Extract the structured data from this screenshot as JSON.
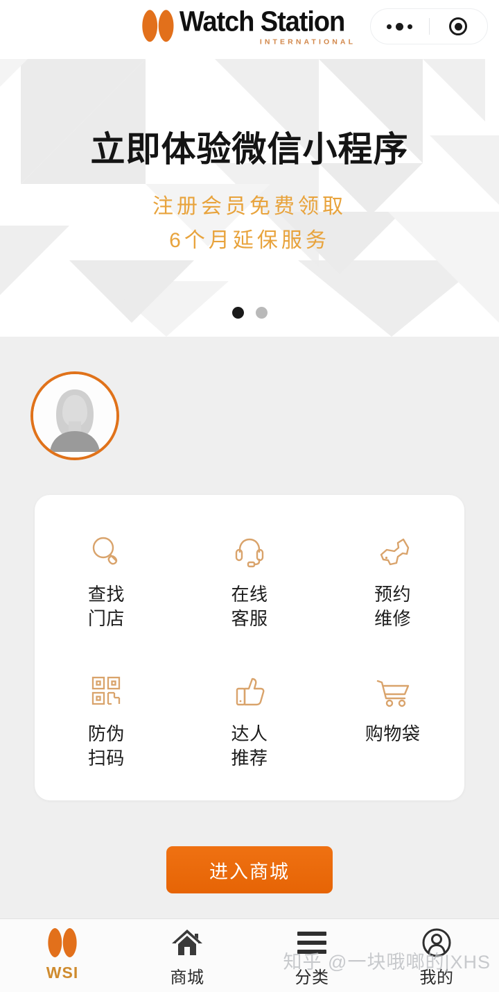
{
  "header": {
    "logo_word": "Watch Station",
    "logo_sub": "INTERNATIONAL",
    "logo_icon": "watch-station-petals-logo",
    "capsule": {
      "menu_icon": "ellipsis-icon",
      "close_icon": "target-circle-icon"
    }
  },
  "banner": {
    "title": "立即体验微信小程序",
    "subtitle_line1": "注册会员免费领取",
    "subtitle_line2": "6个月延保服务",
    "accent_color": "#e8a33c",
    "title_color": "#141414",
    "dots": [
      {
        "active": true
      },
      {
        "active": false
      }
    ]
  },
  "profile": {
    "avatar_icon": "default-user-avatar-icon",
    "avatar_ring_color": "#e0721a"
  },
  "menu_card": {
    "icon_color": "#d9a36b",
    "rows": [
      [
        {
          "icon": "magnifier-icon",
          "line1": "查找",
          "line2": "门店"
        },
        {
          "icon": "headset-icon",
          "line1": "在线",
          "line2": "客服"
        },
        {
          "icon": "wrench-icon",
          "line1": "预约",
          "line2": "维修"
        }
      ],
      [
        {
          "icon": "qr-code-icon",
          "line1": "防伪",
          "line2": "扫码"
        },
        {
          "icon": "thumbs-up-icon",
          "line1": "达人",
          "line2": "推荐"
        },
        {
          "icon": "shopping-cart-icon",
          "line1": "购物袋",
          "line2": ""
        }
      ]
    ]
  },
  "cta": {
    "label": "进入商城",
    "color": "#ec6a07"
  },
  "tabbar": {
    "items": [
      {
        "label": "WSI",
        "icon": "watch-station-petals-icon",
        "active": true
      },
      {
        "label": "商城",
        "icon": "home-icon",
        "active": false
      },
      {
        "label": "分类",
        "icon": "hamburger-menu-icon",
        "active": false
      },
      {
        "label": "我的",
        "icon": "user-circle-icon",
        "active": false
      }
    ],
    "active_color": "#cf8b2e"
  },
  "watermark": {
    "text": "知乎 @一块哦啷的|XHS"
  }
}
